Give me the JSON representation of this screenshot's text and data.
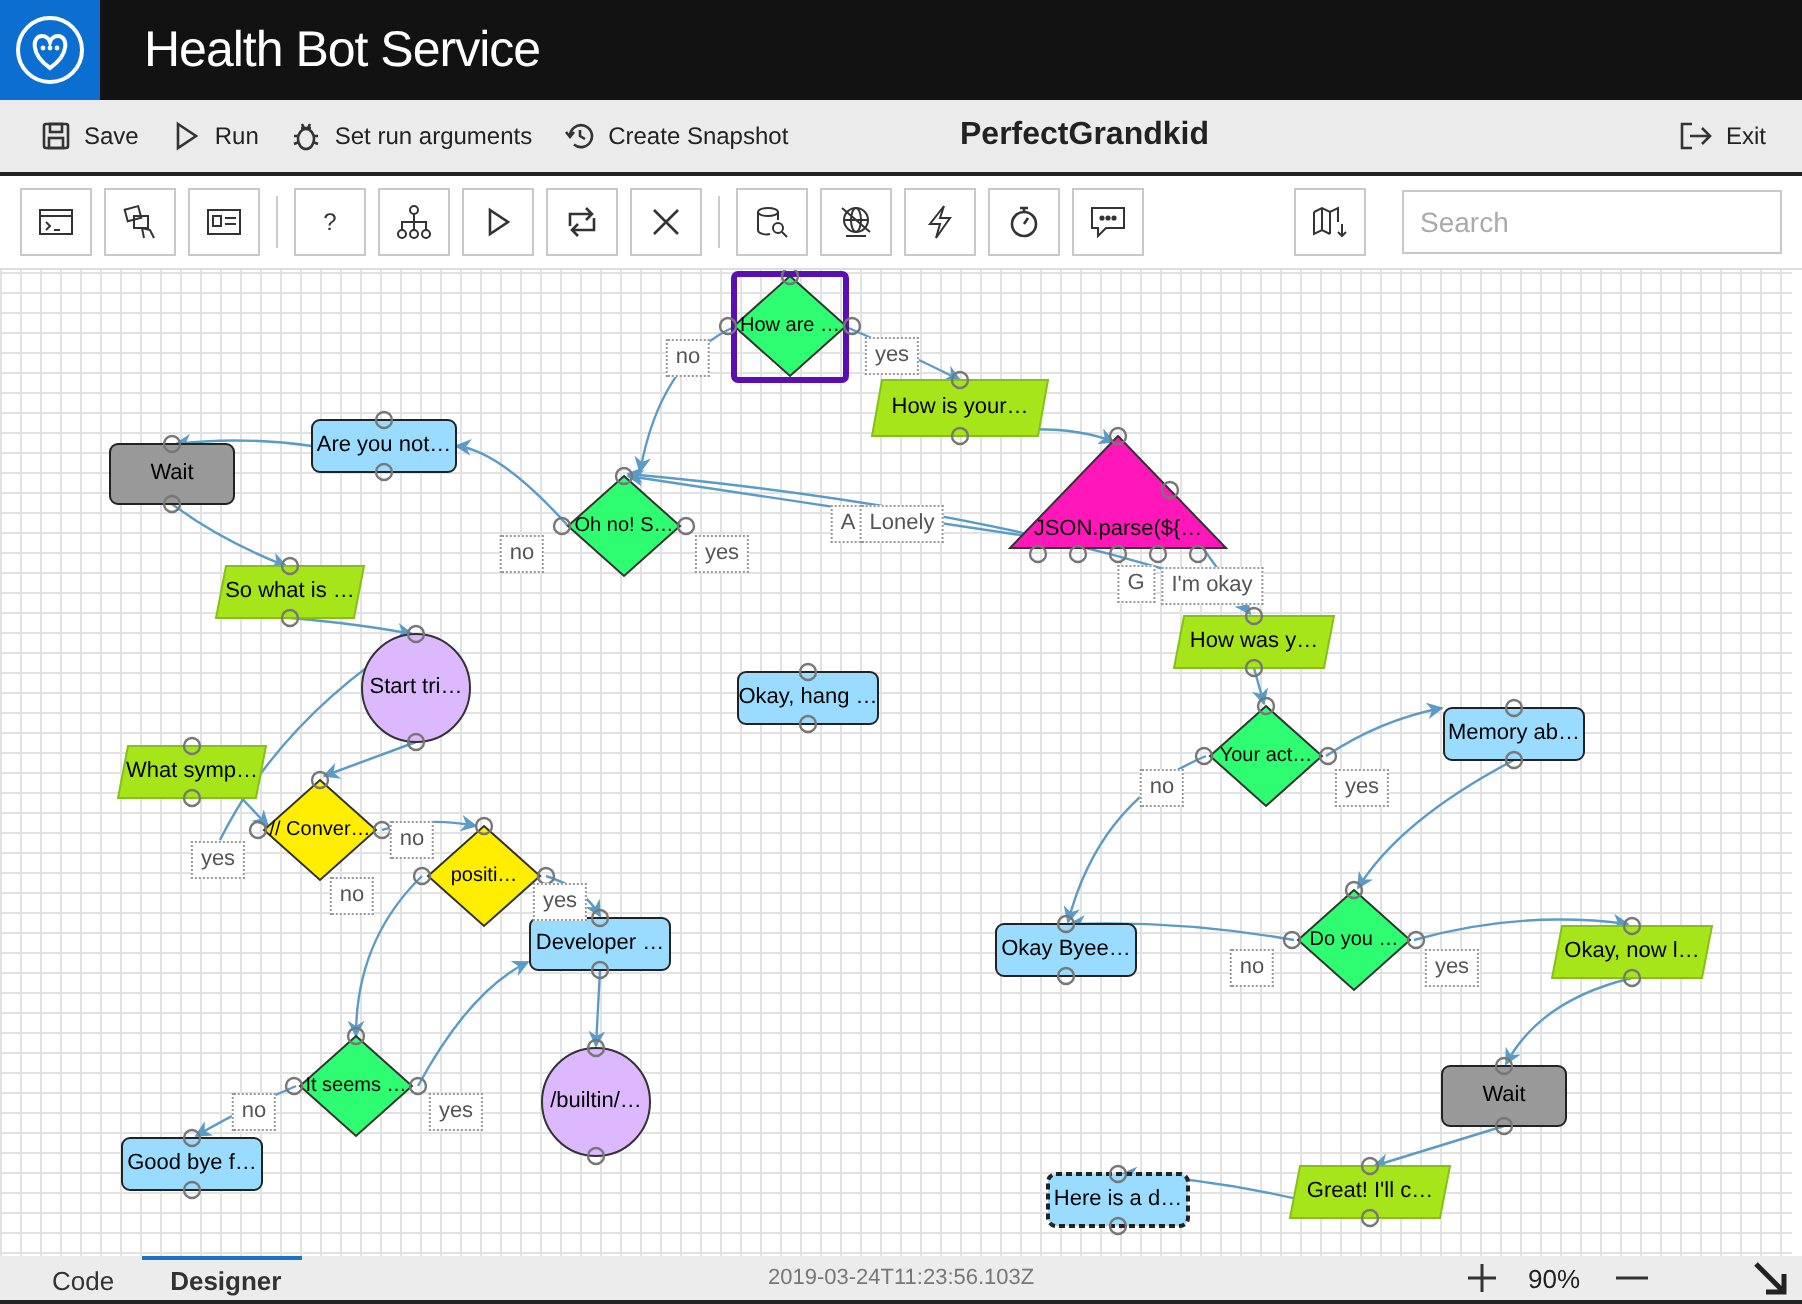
{
  "app": {
    "title": "Health Bot Service"
  },
  "menu": {
    "items": [
      {
        "label": "Save",
        "kind": "save"
      },
      {
        "label": "Run",
        "kind": "run"
      },
      {
        "label": "Set run arguments",
        "kind": "arguments"
      },
      {
        "label": "Create Snapshot",
        "kind": "snapshot"
      }
    ],
    "scenario_title": "PerfectGrandkid",
    "exit": "Exit"
  },
  "toolbar": {
    "help": "?",
    "search": {
      "placeholder": "Search"
    }
  },
  "nodes": [
    {
      "kind": "decision",
      "text": "How are …",
      "color": "#2efc71",
      "selected": true,
      "focused": false
    },
    {
      "kind": "prompt",
      "text": "How is your…",
      "color": "#a6e519",
      "selected": false,
      "focused": false
    },
    {
      "kind": "wait",
      "text": "Wait",
      "color": "#999999",
      "selected": false,
      "focused": false
    },
    {
      "kind": "message",
      "text": "Are you not…",
      "color": "#99dcff",
      "selected": false,
      "focused": false
    },
    {
      "kind": "decision",
      "text": "Oh no! S…",
      "color": "#2efc71",
      "selected": false,
      "focused": false
    },
    {
      "kind": "script",
      "text": "JSON.parse(${…",
      "color": "#ff17b9",
      "selected": false,
      "focused": false
    },
    {
      "kind": "prompt",
      "text": "So what is …",
      "color": "#a6e519",
      "selected": false,
      "focused": false
    },
    {
      "kind": "end",
      "text": "Start tri…",
      "color": "#dcb9ff",
      "selected": false,
      "focused": false
    },
    {
      "kind": "message",
      "text": "Okay, hang …",
      "color": "#99dcff",
      "selected": false,
      "focused": false
    },
    {
      "kind": "prompt",
      "text": "How was y…",
      "color": "#a6e519",
      "selected": false,
      "focused": false
    },
    {
      "kind": "prompt",
      "text": "What symp…",
      "color": "#a6e519",
      "selected": false,
      "focused": false
    },
    {
      "kind": "decision",
      "text": "Your act…",
      "color": "#2efc71",
      "selected": false,
      "focused": false
    },
    {
      "kind": "message",
      "text": "Memory ab…",
      "color": "#99dcff",
      "selected": false,
      "focused": false
    },
    {
      "kind": "decision",
      "text": "// Conver…",
      "color": "#ffee00",
      "selected": false,
      "focused": false
    },
    {
      "kind": "decision",
      "text": "positi…",
      "color": "#ffee00",
      "selected": false,
      "focused": false
    },
    {
      "kind": "message",
      "text": "Developer …",
      "color": "#99dcff",
      "selected": false,
      "focused": false
    },
    {
      "kind": "message",
      "text": "Okay Byee…",
      "color": "#99dcff",
      "selected": false,
      "focused": false
    },
    {
      "kind": "decision",
      "text": "Do you …",
      "color": "#2efc71",
      "selected": false,
      "focused": false
    },
    {
      "kind": "prompt",
      "text": "Okay, now l…",
      "color": "#a6e519",
      "selected": false,
      "focused": false
    },
    {
      "kind": "decision",
      "text": "It seems …",
      "color": "#2efc71",
      "selected": false,
      "focused": false
    },
    {
      "kind": "end",
      "text": "/builtin/…",
      "color": "#dcb9ff",
      "selected": false,
      "focused": false
    },
    {
      "kind": "wait",
      "text": "Wait",
      "color": "#999999",
      "selected": false,
      "focused": false
    },
    {
      "kind": "message",
      "text": "Good bye f…",
      "color": "#99dcff",
      "selected": false,
      "focused": false
    },
    {
      "kind": "message",
      "text": "Here is a d…",
      "color": "#99dcff",
      "selected": false,
      "focused": true
    },
    {
      "kind": "prompt",
      "text": "Great! I'll c…",
      "color": "#a6e519",
      "selected": false,
      "focused": false
    }
  ],
  "edge_labels": [
    {
      "text": "no"
    },
    {
      "text": "yes"
    },
    {
      "text": "no"
    },
    {
      "text": "yes"
    },
    {
      "text": "A"
    },
    {
      "text": "Lonely"
    },
    {
      "text": "G"
    },
    {
      "text": "I'm okay"
    },
    {
      "text": "no"
    },
    {
      "text": "yes"
    },
    {
      "text": "yes"
    },
    {
      "text": "no"
    },
    {
      "text": "no"
    },
    {
      "text": "yes"
    },
    {
      "text": "no"
    },
    {
      "text": "yes"
    },
    {
      "text": "no"
    },
    {
      "text": "yes"
    }
  ],
  "tabs": [
    {
      "label": "Code",
      "selected": false
    },
    {
      "label": "Designer",
      "selected": true
    }
  ],
  "timestamp": "2019-03-24T11:23:56.103Z",
  "zoom": "90%"
}
